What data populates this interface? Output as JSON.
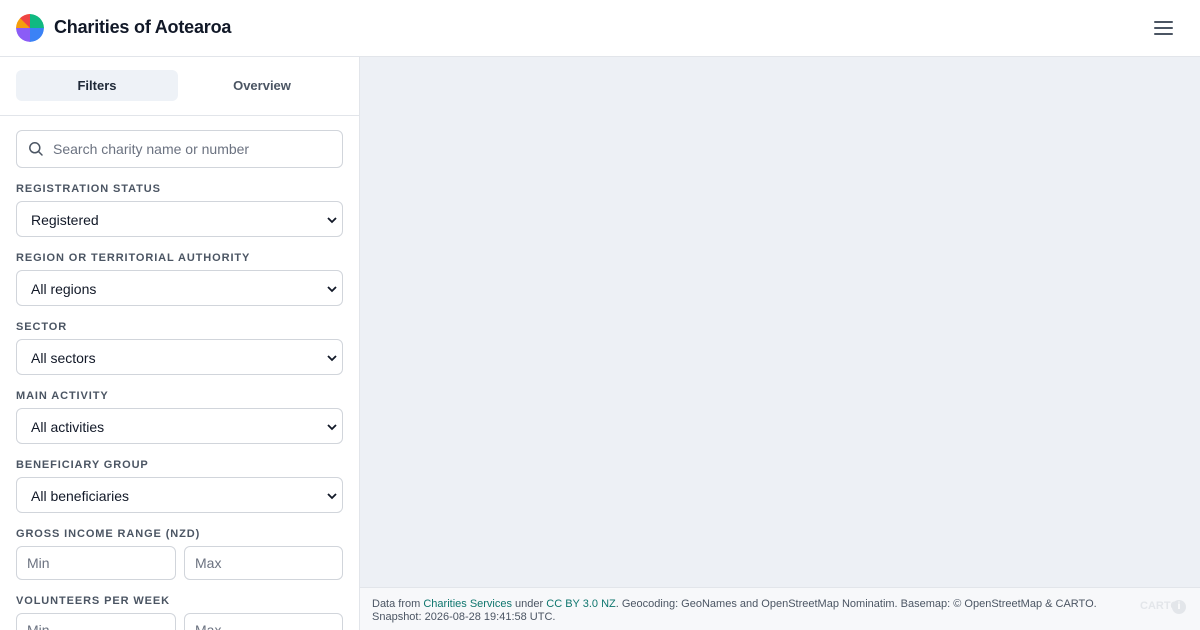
{
  "header": {
    "brand": "Charities of Aotearoa",
    "logo_colors": [
      "#ef4444",
      "#f59e0b",
      "#10b981",
      "#3b82f6",
      "#8b5cf6"
    ],
    "menu_icon": "hamburger-menu-icon"
  },
  "sidebar": {
    "tabs": [
      {
        "label": "Filters",
        "active": true
      },
      {
        "label": "Overview",
        "active": false
      }
    ],
    "search": {
      "placeholder": "Search charity name or number",
      "value": "",
      "icon": "search-icon"
    },
    "filters": {
      "registration_status": {
        "label": "REGISTRATION STATUS",
        "value": "Registered"
      },
      "region": {
        "label": "REGION OR TERRITORIAL AUTHORITY",
        "value": "All regions"
      },
      "sector": {
        "label": "SECTOR",
        "value": "All sectors"
      },
      "main_activity": {
        "label": "MAIN ACTIVITY",
        "value": "All activities"
      },
      "beneficiary": {
        "label": "BENEFICIARY GROUP",
        "value": "All beneficiaries"
      },
      "gross_income": {
        "label": "GROSS INCOME RANGE (NZD)",
        "min_placeholder": "Min",
        "max_placeholder": "Max"
      },
      "volunteers": {
        "label": "VOLUNTEERS PER WEEK",
        "min_placeholder": "Min",
        "max_placeholder": "Max"
      }
    }
  },
  "attribution": {
    "prefix": "Data from ",
    "source_link": "Charities Services",
    "under": " under ",
    "license_link": "CC BY 3.0 NZ",
    "rest": ". Geocoding: GeoNames and OpenStreetMap Nominatim. Basemap: © OpenStreetMap & CARTO.",
    "snapshot": "Snapshot: 2026-08-28 19:41:58 UTC.",
    "carto_label": "CARTO",
    "info_symbol": "i"
  },
  "colors": {
    "map_background": "#edf0f5",
    "link": "#0f766e",
    "active_tab": "#eef2f7"
  }
}
